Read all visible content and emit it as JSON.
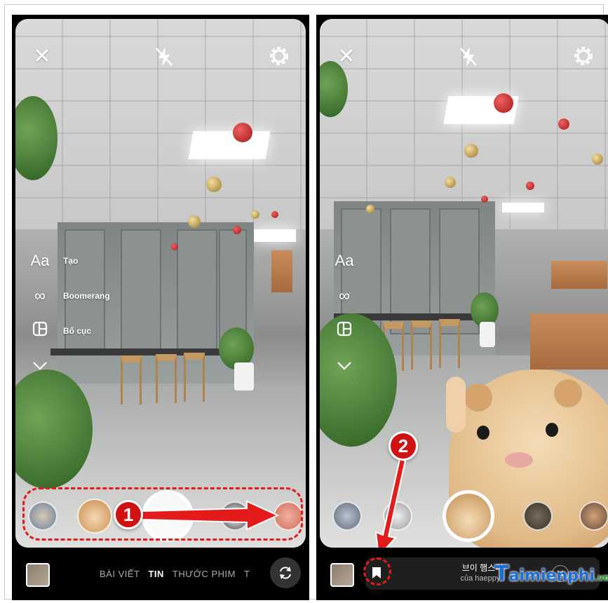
{
  "left_screen": {
    "top_icons": [
      "close-icon",
      "flash-off-icon",
      "settings-icon"
    ],
    "side_menu": [
      {
        "icon": "Aa",
        "label": "Tạo"
      },
      {
        "icon": "∞",
        "label": "Boomerang"
      },
      {
        "icon": "layout-icon",
        "label": "Bố cục"
      },
      {
        "icon": "chevron-down-icon",
        "label": ""
      }
    ],
    "modes": [
      "BÀI VIẾT",
      "TIN",
      "THƯỚC PHIM",
      "T"
    ],
    "active_mode": "TIN",
    "step_badge": "1"
  },
  "right_screen": {
    "top_icons": [
      "close-icon",
      "flash-off-icon",
      "settings-icon"
    ],
    "side_menu": [
      {
        "icon": "Aa"
      },
      {
        "icon": "∞"
      },
      {
        "icon": "layout-icon"
      },
      {
        "icon": "chevron-down-icon"
      }
    ],
    "effect": {
      "name": "브이 햄스터",
      "author": "của haeppyri"
    },
    "step_badge": "2"
  },
  "watermark": {
    "text": "aimienphi",
    "suffix": ".vn"
  },
  "colors": {
    "annotation_red": "#e41b1b",
    "badge_red": "#d11212",
    "watermark_blue": "#1a6fd6"
  }
}
